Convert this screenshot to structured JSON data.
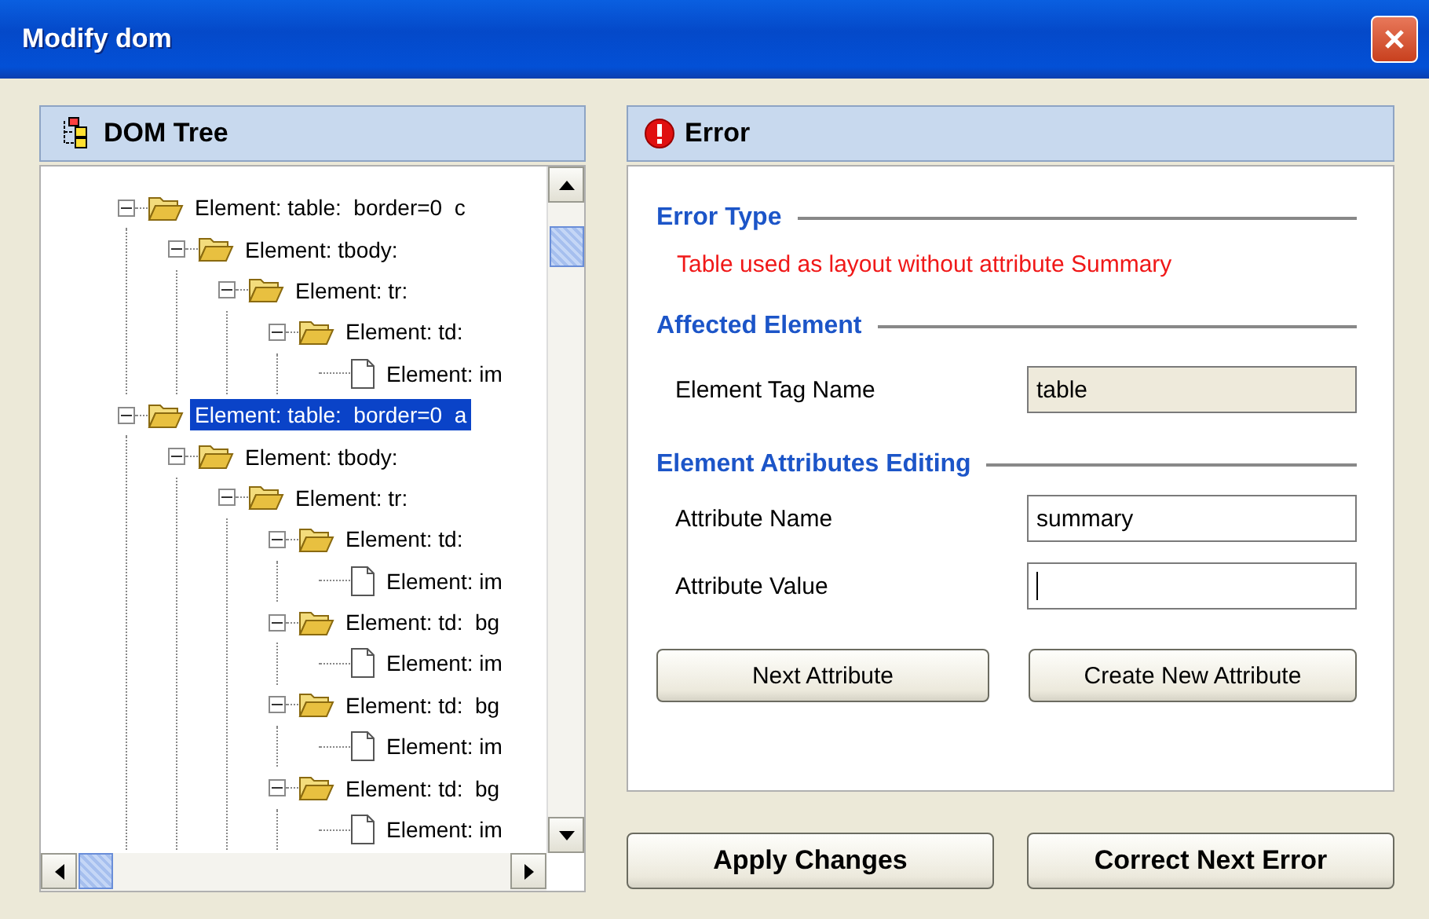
{
  "window": {
    "title": "Modify dom"
  },
  "tree_panel": {
    "title": "DOM Tree",
    "nodes": [
      {
        "label": "Element: table:  border=0  c",
        "expanded": true,
        "selected": false,
        "children": [
          {
            "label": "Element: tbody:",
            "expanded": true,
            "selected": false,
            "children": [
              {
                "label": "Element: tr:",
                "expanded": true,
                "selected": false,
                "children": [
                  {
                    "label": "Element: td:",
                    "expanded": true,
                    "selected": false,
                    "children": [
                      {
                        "label": "Element: im",
                        "selected": false
                      }
                    ]
                  }
                ]
              }
            ]
          }
        ]
      },
      {
        "label": "Element: table:  border=0  a",
        "expanded": true,
        "selected": true,
        "children": [
          {
            "label": "Element: tbody:",
            "expanded": true,
            "selected": false,
            "children": [
              {
                "label": "Element: tr:",
                "expanded": true,
                "selected": false,
                "children": [
                  {
                    "label": "Element: td:",
                    "expanded": true,
                    "selected": false,
                    "children": [
                      {
                        "label": "Element: im",
                        "selected": false
                      }
                    ]
                  },
                  {
                    "label": "Element: td:  bg",
                    "expanded": true,
                    "selected": false,
                    "children": [
                      {
                        "label": "Element: im",
                        "selected": false
                      }
                    ]
                  },
                  {
                    "label": "Element: td:  bg",
                    "expanded": true,
                    "selected": false,
                    "children": [
                      {
                        "label": "Element: im",
                        "selected": false
                      }
                    ]
                  },
                  {
                    "label": "Element: td:  bg",
                    "expanded": true,
                    "selected": false,
                    "children": [
                      {
                        "label": "Element: im",
                        "selected": false
                      }
                    ]
                  }
                ]
              }
            ]
          }
        ]
      }
    ]
  },
  "error_panel": {
    "title": "Error",
    "error_type": {
      "heading": "Error Type",
      "message": "Table used as layout without attribute Summary"
    },
    "affected_element": {
      "heading": "Affected Element",
      "label": "Element Tag Name",
      "value": "table"
    },
    "attributes_editing": {
      "heading": "Element Attributes Editing",
      "fields": [
        {
          "label": "Attribute Name",
          "value": "summary",
          "focused": false
        },
        {
          "label": "Attribute Value",
          "focused": true
        }
      ],
      "buttons": [
        "Next Attribute",
        "Create New Attribute"
      ]
    }
  },
  "buttons": [
    "Apply Changes",
    "Correct Next Error"
  ]
}
